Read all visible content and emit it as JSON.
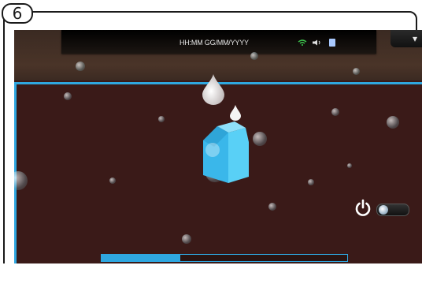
{
  "step": {
    "number": "6"
  },
  "status_bar": {
    "datetime": "HH:MM GG/MM/YYYY",
    "wifi_icon": "wifi-icon",
    "speaker_icon": "speaker-icon",
    "usb_icon": "usb-icon"
  },
  "colors": {
    "accent": "#2fa7e0",
    "background": "#3a1a18",
    "carton": "#4cc4f0"
  },
  "illustration": {
    "drop_top_icon": "water-drop-icon",
    "drop_small_icon": "water-drop-icon",
    "carton_icon": "milk-carton-icon"
  },
  "controls": {
    "power_icon": "power-icon",
    "toggle_state": "on"
  },
  "progress": {
    "fraction": 0.32
  }
}
